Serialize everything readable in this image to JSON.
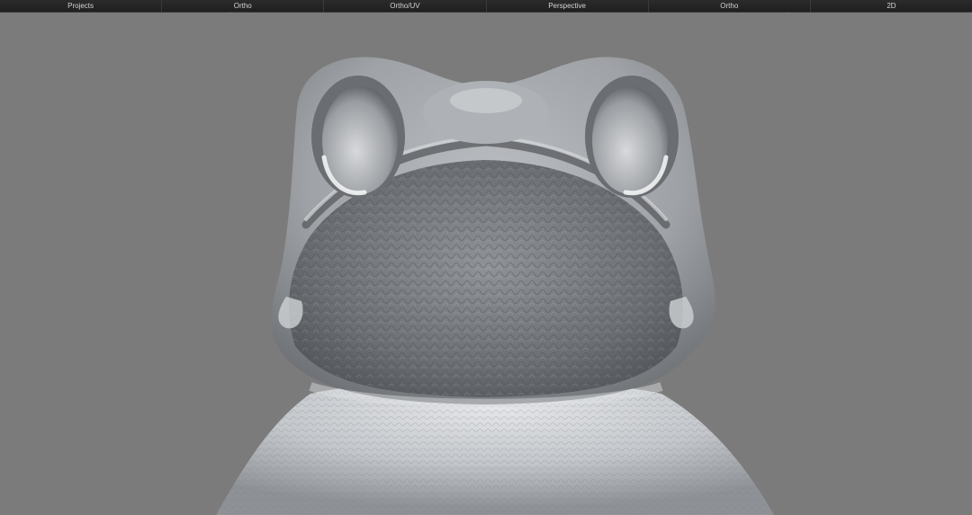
{
  "tabs": [
    {
      "label": "Projects"
    },
    {
      "label": "Ortho"
    },
    {
      "label": "Ortho/UV"
    },
    {
      "label": "Perspective"
    },
    {
      "label": "Ortho"
    },
    {
      "label": "2D"
    }
  ],
  "viewport": {
    "background_color": "#7b7b7b",
    "model_color": "#b9bcc0",
    "subject": "frog sculpt"
  }
}
